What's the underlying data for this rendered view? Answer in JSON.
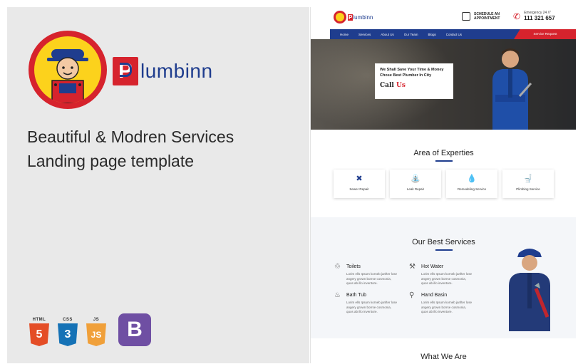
{
  "left": {
    "brand_letter": "P",
    "brand_name": "lumbinn",
    "headline_line1": "Beautiful & Modren Services",
    "headline_line2": "Landing page template",
    "techs": [
      {
        "label": "HTML",
        "glyph": "5",
        "color": "#e44d26"
      },
      {
        "label": "CSS",
        "glyph": "3",
        "color": "#1572b6"
      },
      {
        "label": "JS",
        "glyph": "JS",
        "color": "#f0a03a"
      }
    ],
    "bootstrap_glyph": "B"
  },
  "site": {
    "brand_letter": "P",
    "brand_name": "lumbinn",
    "schedule_line1": "SCHEDULE AN",
    "schedule_line2": "APPOINTMENT",
    "emergency_label": "Emergency 24 /7",
    "emergency_number": "111 321 657",
    "nav": [
      "Home",
      "Services",
      "About Us",
      "Our Team",
      "Blogs",
      "Contact Us"
    ],
    "nav_cta": "Service Request",
    "hero_line1": "We Shall Save Your Time & Money",
    "hero_line2": "Chose Best Plumber In City",
    "hero_call": "Call",
    "hero_us": "Us",
    "expertise_title": "Area of Experties",
    "cards": [
      {
        "label": "Sewer Repair",
        "icon": "wrench-icon",
        "glyph": "✖"
      },
      {
        "label": "Leak Repair",
        "icon": "faucet-icon",
        "glyph": "⛲"
      },
      {
        "label": "Remodeling Service",
        "icon": "drop-icon",
        "glyph": "💧"
      },
      {
        "label": "Plimbing Service",
        "icon": "toilet-icon",
        "glyph": "🚽"
      }
    ],
    "services_title": "Our Best Services",
    "services": [
      {
        "title": "Toilets",
        "desc_line1": "Lorim ells Ipsum korneb janfter lose",
        "desc_line2": "angery grown borrse cosmonia,",
        "desc_line3": "quos ab illo inventore."
      },
      {
        "title": "Hot Water",
        "desc_line1": "Lorim ells Ipsum korneb janfter lose",
        "desc_line2": "angery grown borrse cosmonia,",
        "desc_line3": "quos ab illo inventore."
      },
      {
        "title": "Bath Tub",
        "desc_line1": "Lorim ells Ipsum korneb janfter lose",
        "desc_line2": "angery grown borrse cosmonia,",
        "desc_line3": "quos ab illo inventore."
      },
      {
        "title": "Hand Basin",
        "desc_line1": "Lorim ells Ipsum korneb janfter lose",
        "desc_line2": "angery grown borrse cosmonia,",
        "desc_line3": "quos ab illo inventore."
      }
    ],
    "what_title": "What We Are"
  },
  "colors": {
    "brand_red": "#d6232d",
    "brand_blue": "#1f3d8e",
    "mascot_yellow": "#fcd21c",
    "bootstrap_purple": "#6f4fa3"
  }
}
